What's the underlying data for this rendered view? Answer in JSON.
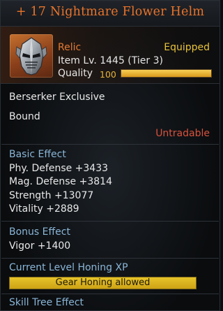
{
  "title": "+ 17 Nightmare Flower Helm",
  "header": {
    "grade": "Relic",
    "status": "Equipped",
    "item_level": "Item Lv. 1445 (Tier 3)",
    "quality_label": "Quality",
    "quality_value": "100",
    "quality_fraction": 1.0
  },
  "info": {
    "class_restriction": "Berserker Exclusive",
    "bind": "Bound",
    "trade": "Untradable"
  },
  "basic_effect": {
    "label": "Basic Effect",
    "stats": [
      "Phy. Defense +3433",
      "Mag. Defense +3814",
      "Strength +13077",
      "Vitality +2889"
    ]
  },
  "bonus_effect": {
    "label": "Bonus Effect",
    "stats": [
      "Vigor +1400"
    ]
  },
  "honing": {
    "label": "Current Level Honing XP",
    "bar_text": "Gear Honing allowed"
  },
  "skill_tree": {
    "label": "Skill Tree Effect"
  },
  "icons": {
    "item": "helm-icon"
  },
  "colors": {
    "title": "#e8732a",
    "grade_relic": "#e47a33",
    "equipped": "#e7c23a",
    "untradable": "#d8523c",
    "section": "#8ab6d8",
    "quality_bar": "#e7b33a"
  }
}
